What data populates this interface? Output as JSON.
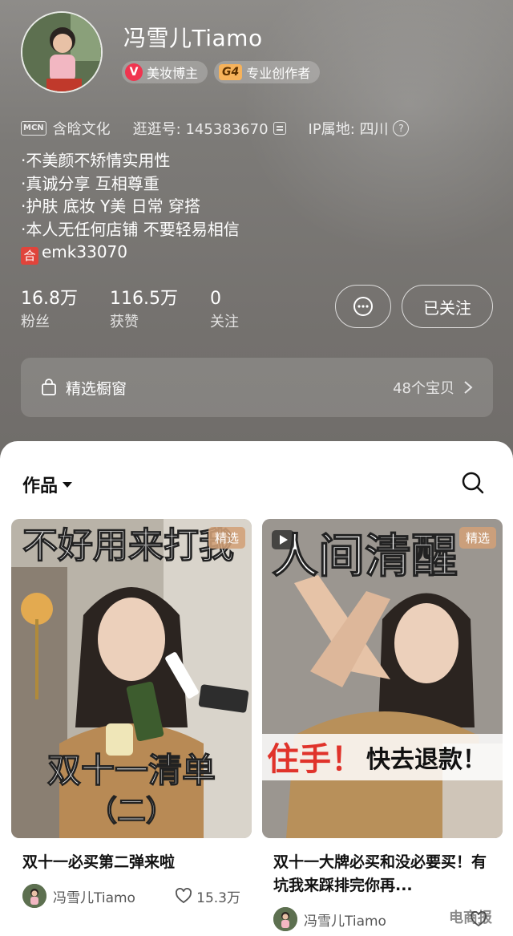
{
  "profile": {
    "username": "冯雪儿Tiamo",
    "badges": {
      "beauty": "美妆博主",
      "level": "G4",
      "creator": "专业创作者"
    },
    "mcn_icon": "MCN",
    "mcn_name": "含晗文化",
    "id_label": "逛逛号: 145383670",
    "ip_label": "IP属地: 四川",
    "bio": [
      "·不美颜不矫情实用性",
      "·真诚分享 互相尊重",
      "·护肤 底妆 Y美 日常 穿搭",
      "·本人无任何店铺 不要轻易相信"
    ],
    "contact_icon": "合",
    "contact": "emk33070",
    "stats": [
      {
        "value": "16.8万",
        "label": "粉丝"
      },
      {
        "value": "116.5万",
        "label": "获赞"
      },
      {
        "value": "0",
        "label": "关注"
      }
    ],
    "follow_label": "已关注",
    "showcase": {
      "label": "精选橱窗",
      "count": "48个宝贝"
    }
  },
  "works": {
    "tab_label": "作品",
    "cards": [
      {
        "cover_headline": "不好用来打我",
        "tag": "精选",
        "cover_title": "双十一清单",
        "cover_subtitle": "（二）",
        "title": "双十一必买第二弹来啦",
        "author": "冯雪儿Tiamo",
        "likes": "15.3万"
      },
      {
        "cover_headline": "人间清醒",
        "tag": "精选",
        "cover_caption_red": "住手！",
        "cover_caption_black": "快去退款！",
        "title": "双十一大牌必买和没必要买！有坑我来踩排完你再...",
        "author": "冯雪儿Tiamo",
        "likes": ""
      }
    ]
  },
  "watermark": "电商报",
  "colors": {
    "accent_red": "#f0344f",
    "badge_gold": "#f6b25a",
    "header_bg": "#7c7a77"
  }
}
